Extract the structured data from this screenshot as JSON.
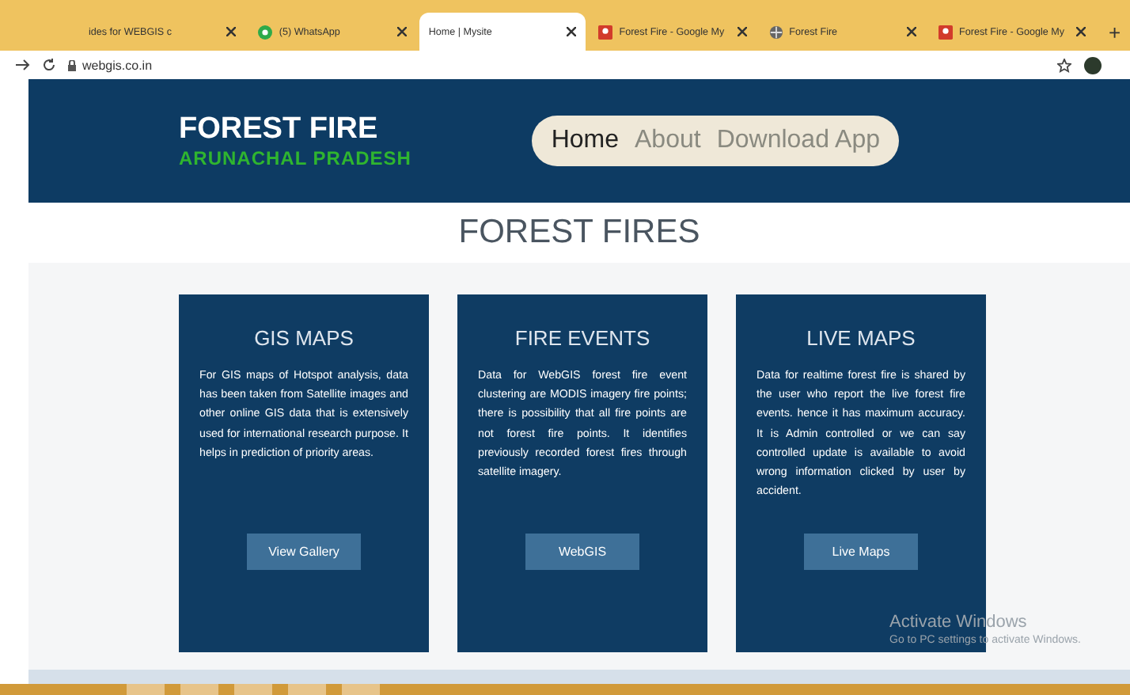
{
  "browser": {
    "tabs": [
      {
        "title": "ides for WEBGIS c",
        "kind": "none",
        "selected": false
      },
      {
        "title": "(5) WhatsApp",
        "kind": "chat",
        "selected": false
      },
      {
        "title": "Home | Mysite",
        "kind": "none",
        "selected": true
      },
      {
        "title": "Forest Fire - Google My",
        "kind": "pin",
        "selected": false
      },
      {
        "title": "Forest Fire",
        "kind": "globe",
        "selected": false
      },
      {
        "title": "Forest Fire - Google My",
        "kind": "pin",
        "selected": false
      }
    ],
    "new_tab": "+",
    "url": "webgis.co.in"
  },
  "site": {
    "title": "FOREST FIRE",
    "subtitle": "ARUNACHAL PRADESH",
    "nav": [
      {
        "label": "Home",
        "selected": true
      },
      {
        "label": "About",
        "selected": false
      },
      {
        "label": "Download App",
        "selected": false
      }
    ]
  },
  "section_title": "FOREST FIRES",
  "cards": [
    {
      "title": "GIS MAPS",
      "text": "For GIS maps of Hotspot analysis, data has been taken from Satellite images and other online GIS data that is extensively used for international research purpose. It helps in prediction of priority areas.",
      "button": "View Gallery"
    },
    {
      "title": "FIRE EVENTS",
      "text": "Data for WebGIS forest fire event clustering are MODIS imagery fire points; there is possibility that all fire points are not forest fire points. It identifies previously recorded forest fires through satellite imagery.",
      "button": "WebGIS"
    },
    {
      "title": "LIVE MAPS",
      "text": "Data for realtime forest fire is shared by the user who report the live forest fire events. hence it has maximum accuracy. It is Admin controlled or we can say controlled update is available to avoid wrong information clicked by user by accident.",
      "button": "Live Maps"
    }
  ],
  "os_notice": {
    "title": "Activate Windows",
    "text": "Go to PC settings to activate Windows."
  }
}
